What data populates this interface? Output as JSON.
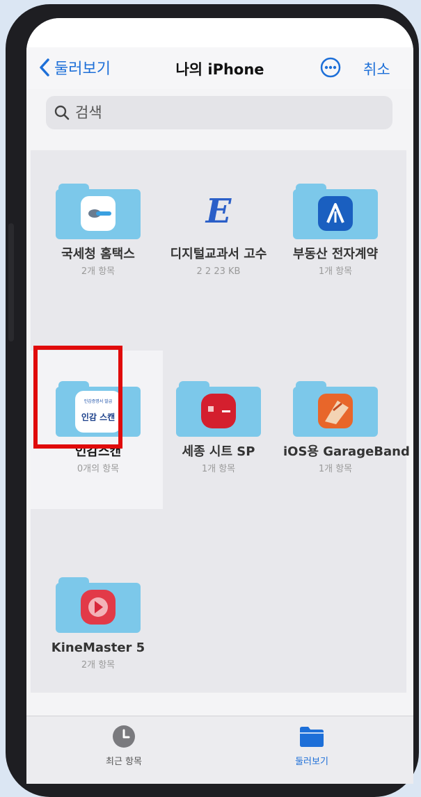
{
  "nav": {
    "back_label": "둘러보기",
    "title": "나의 iPhone",
    "cancel_label": "취소"
  },
  "search": {
    "placeholder": "검색"
  },
  "items": [
    {
      "name": "국세청 홈택스",
      "meta": "2개 항목"
    },
    {
      "name": "디지털교과서 고수",
      "meta": "2 2 23 KB"
    },
    {
      "name": "부동산 전자계약",
      "meta": "1개 항목"
    },
    {
      "name": "인감스캔",
      "meta": "0개의 항목"
    },
    {
      "name": "세종 시트 SP",
      "meta": "1개 항목"
    },
    {
      "name": "iOS용 GarageBand",
      "meta": "1개 항목"
    },
    {
      "name": "KineMaster 5",
      "meta": "2개 항목"
    }
  ],
  "app_badge": {
    "small_text": "인감증명서 발급",
    "text": "인감 스캔"
  },
  "tabbar": {
    "recent_label": "최근 항목",
    "browse_label": "둘러보기"
  },
  "colors": {
    "accent": "#1d6fd8",
    "folder": "#7cc8ea",
    "highlight": "#e00b0b"
  }
}
